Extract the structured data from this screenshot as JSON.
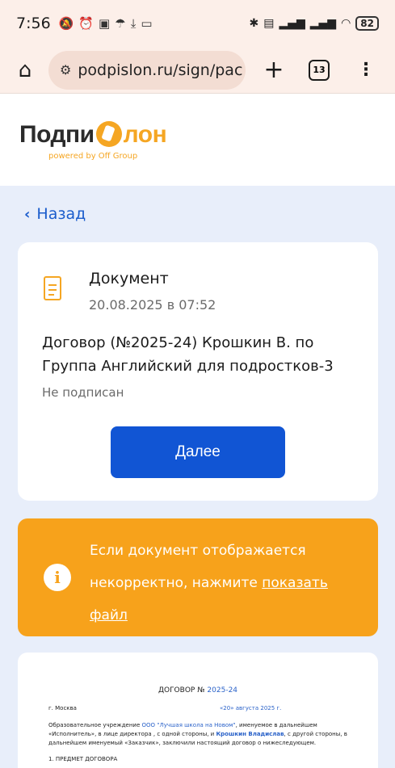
{
  "status_bar": {
    "time": "7:56",
    "left_icons": [
      "bell-off-icon",
      "alarm-icon",
      "nfc-icon",
      "umbrella-icon",
      "download-icon",
      "card-icon"
    ],
    "right_icons": [
      "bluetooth-icon",
      "volte-icon",
      "signal-icon",
      "signal-icon",
      "wifi-icon"
    ],
    "battery": "82"
  },
  "browser": {
    "url": "podpislon.ru/sign/pac",
    "tab_count": "13"
  },
  "brand": {
    "logo_left": "Подпи",
    "logo_right": "лон",
    "tagline": "powered by Off Group",
    "accent_color": "#f5a623"
  },
  "nav": {
    "back_label": "Назад",
    "link_color": "#1a5ccc"
  },
  "document_card": {
    "title": "Документ",
    "date": "20.08.2025 в 07:52",
    "name": "Договор (№2025-24) Крошкин В. по Группа Английский для подростков-3",
    "status": "Не подписан",
    "next_button": "Далее",
    "button_color": "#1155d4"
  },
  "warning": {
    "text": "Если документ отображается некорректно, нажмите ",
    "link": "показать файл",
    "bg_color": "#f7a21b"
  },
  "preview": {
    "title_prefix": "ДОГОВОР № ",
    "title_number": "2025-24",
    "city": "г. Москва",
    "date": "«20» августа 2025 г.",
    "body_1": "Образовательное учреждение ",
    "org": "ООО \"Лучшая школа на Новом\"",
    "body_2": ", именуемое в дальнейшем «Исполнитель», в лице директора , с одной стороны, и ",
    "client": "Крошкин Владислав",
    "body_3": ", с другой стороны, в дальнейшем именуемый «Заказчик», заключили настоящий договор о нижеследующем.",
    "section": "1. ПРЕДМЕТ ДОГОВОРА"
  }
}
